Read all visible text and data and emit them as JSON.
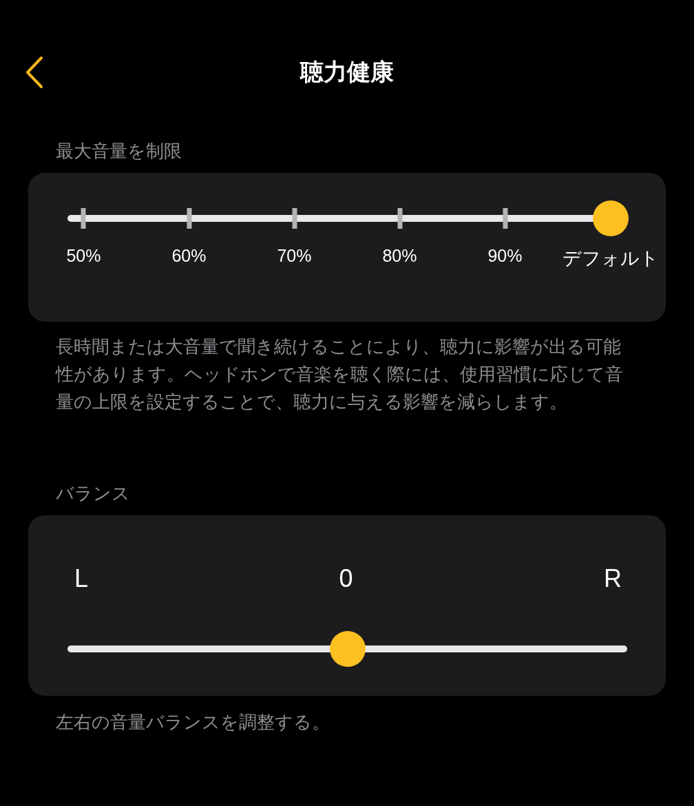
{
  "header": {
    "title": "聴力健康"
  },
  "volume_limit": {
    "label": "最大音量を制限",
    "stops": [
      {
        "label": "50%",
        "selected": false
      },
      {
        "label": "60%",
        "selected": false
      },
      {
        "label": "70%",
        "selected": false
      },
      {
        "label": "80%",
        "selected": false
      },
      {
        "label": "90%",
        "selected": false
      },
      {
        "label": "デフォルト",
        "selected": true
      }
    ],
    "description": "長時間または大音量で聞き続けることにより、聴力に影響が出る可能性があります。ヘッドホンで音楽を聴く際には、使用習慣に応じて音量の上限を設定することで、聴力に与える影響を減らします。"
  },
  "balance": {
    "label": "バランス",
    "left_label": "L",
    "center_label": "0",
    "right_label": "R",
    "level": 0.5,
    "description": "左右の音量バランスを調整する。"
  }
}
